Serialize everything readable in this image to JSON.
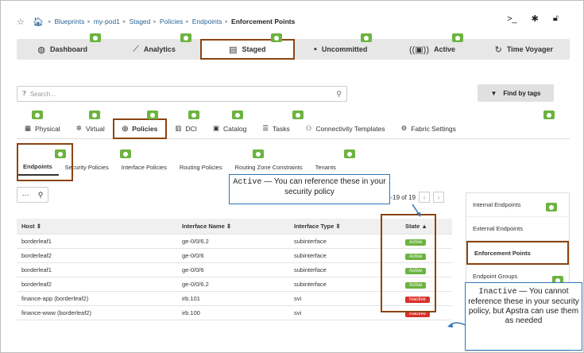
{
  "breadcrumb": [
    "Blueprints",
    "my-pod1",
    "Staged",
    "Policies",
    "Endpoints",
    "Enforcement Points"
  ],
  "top_tabs": [
    {
      "label": "Dashboard",
      "icon": "dashboard-icon",
      "glyph": "◍"
    },
    {
      "label": "Analytics",
      "icon": "chart-icon",
      "glyph": "⟋"
    },
    {
      "label": "Staged",
      "icon": "document-icon",
      "glyph": "▤"
    },
    {
      "label": "Uncommitted",
      "icon": "uncommitted-icon",
      "glyph": "▪"
    },
    {
      "label": "Active",
      "icon": "active-icon",
      "glyph": "((▣))"
    },
    {
      "label": "Time Voyager",
      "icon": "history-icon",
      "glyph": "↻"
    }
  ],
  "search": {
    "placeholder": "Search..."
  },
  "find_by_tags": "Find by tags",
  "sub_tabs": [
    {
      "label": "Physical",
      "glyph": "▦"
    },
    {
      "label": "Virtual",
      "glyph": "✲"
    },
    {
      "label": "Policies",
      "glyph": "◎"
    },
    {
      "label": "DCI",
      "glyph": "▥"
    },
    {
      "label": "Catalog",
      "glyph": "▣"
    },
    {
      "label": "Tasks",
      "glyph": "☰"
    },
    {
      "label": "Connectivity Templates",
      "glyph": "⚇"
    },
    {
      "label": "Fabric Settings",
      "glyph": "⚙"
    }
  ],
  "policy_tabs": [
    "Endpoints",
    "Security Policies",
    "Interface Policies",
    "Routing Policies",
    "Routing Zone Constraints",
    "Tenants"
  ],
  "pager": {
    "text": "1-19 of 19"
  },
  "table": {
    "headers": [
      "Host ⇕",
      "Interface Name ⇕",
      "Interface Type ⇕",
      "State ▲"
    ],
    "rows": [
      [
        "borderleaf1",
        "ge-0/0/6.2",
        "subinterface",
        "Active"
      ],
      [
        "borderleaf2",
        "ge-0/0/6",
        "subinterface",
        "Active"
      ],
      [
        "borderleaf1",
        "ge-0/0/6",
        "subinterface",
        "Active"
      ],
      [
        "borderleaf2",
        "ge-0/0/6.2",
        "subinterface",
        "Active"
      ],
      [
        "finance-app (borderleaf2)",
        "irb.101",
        "svi",
        "Inactive"
      ],
      [
        "finance-www (borderleaf2)",
        "irb.100",
        "svi",
        "Inactive"
      ]
    ]
  },
  "right_panel": [
    "Internal Endpoints",
    "External Endpoints",
    "Enforcement Points",
    "Endpoint Groups"
  ],
  "callouts": {
    "active_term": "Active",
    "active_text": " — You can reference these in your security policy",
    "inactive_term": "Inactive",
    "inactive_text": " — You cannot reference these in your security policy, but Apstra can use them as needed"
  },
  "colors": {
    "accent": "#6cb33f",
    "highlight": "#8b4513",
    "inactive": "#d9302c",
    "callout": "#2e75b6"
  }
}
